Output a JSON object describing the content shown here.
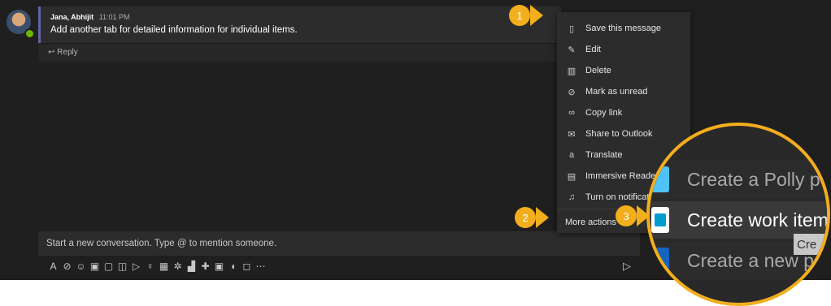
{
  "message": {
    "author": "Jana, Abhijit",
    "time": "11:01 PM",
    "text": "Add another tab for detailed information for individual items.",
    "reply_label": "Reply"
  },
  "composer": {
    "placeholder": "Start a new conversation. Type @ to mention someone."
  },
  "context_menu": {
    "items": [
      {
        "label": "Save this message",
        "icon": "bookmark-icon"
      },
      {
        "label": "Edit",
        "icon": "pencil-icon"
      },
      {
        "label": "Delete",
        "icon": "trash-icon"
      },
      {
        "label": "Mark as unread",
        "icon": "eye-slash-icon"
      },
      {
        "label": "Copy link",
        "icon": "link-icon"
      },
      {
        "label": "Share to Outlook",
        "icon": "mail-icon"
      },
      {
        "label": "Translate",
        "icon": "translate-icon"
      },
      {
        "label": "Immersive Reader",
        "icon": "immersive-reader-icon"
      },
      {
        "label": "Turn on notifications",
        "icon": "bell-icon"
      }
    ],
    "more_actions_label": "More actions"
  },
  "callouts": [
    "1",
    "2",
    "3"
  ],
  "zoom": {
    "items": [
      {
        "label": "Create a Polly poll",
        "color": "#4fc3f7"
      },
      {
        "label": "Create work item",
        "color": "#009ccc"
      },
      {
        "label": "Create a new post",
        "color": "#1565c0"
      }
    ],
    "tooltip": "Cre"
  },
  "colors": {
    "accent": "#6264a7",
    "callout": "#f3ae1d",
    "background": "#201f1f"
  }
}
